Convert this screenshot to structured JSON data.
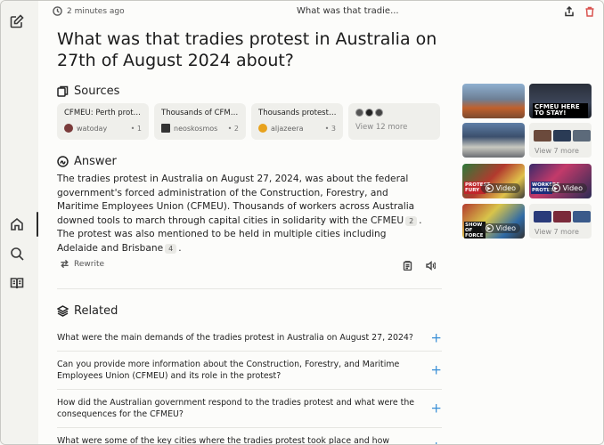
{
  "topbar": {
    "time_label": "2 minutes ago",
    "title": "What was that tradie..."
  },
  "question": "What was that tradies protest in Australia on 27th of August 2024 about?",
  "sources": {
    "heading": "Sources",
    "items": [
      {
        "title": "CFMEU: Perth protes...",
        "domain": "watoday",
        "num": "1",
        "fav_color": "#7a3b3b"
      },
      {
        "title": "Thousands of CFMEU...",
        "domain": "neoskosmos",
        "num": "2",
        "fav_color": "#333333"
      },
      {
        "title": "Thousands protest a...",
        "domain": "aljazeera",
        "num": "3",
        "fav_color": "#e8a21d"
      }
    ],
    "view_more": "View 12 more"
  },
  "answer": {
    "heading": "Answer",
    "part1": "The tradies protest in Australia on August 27, 2024, was about the federal government's forced administration of the Construction, Forestry, and Maritime Employees Union (CFMEU). Thousands of workers across Australia downed tools to march through capital cities in solidarity with the CFMEU",
    "cite1": "2",
    "part2": ". The protest was also mentioned to be held in multiple cities including Adelaide and Brisbane",
    "cite2": "4",
    "part3": "."
  },
  "actions": {
    "rewrite": "Rewrite"
  },
  "related": {
    "heading": "Related",
    "items": [
      "What were the main demands of the tradies protest in Australia on August 27, 2024?",
      "Can you provide more information about the Construction, Forestry, and Maritime Employees Union (CFMEU) and its role in the protest?",
      "How did the Australian government respond to the tradies protest and what were the consequences for the CFMEU?",
      "What were some of the key cities where the tradies protest took place and how many"
    ]
  },
  "media": {
    "thumb2_text": "CFMEU HERE TO STAY!",
    "video_label": "Video",
    "thumb5_text": "PROTEST FURY",
    "thumb6_text": "WORKERS PROTEST",
    "thumb7_text": "SHOW OF FORCE",
    "view_more_images": "View 7 more",
    "view_more_videos": "View 7 more"
  },
  "colors": {
    "accent_plus": "#3a8fd6",
    "delete_red": "#d9534f"
  }
}
